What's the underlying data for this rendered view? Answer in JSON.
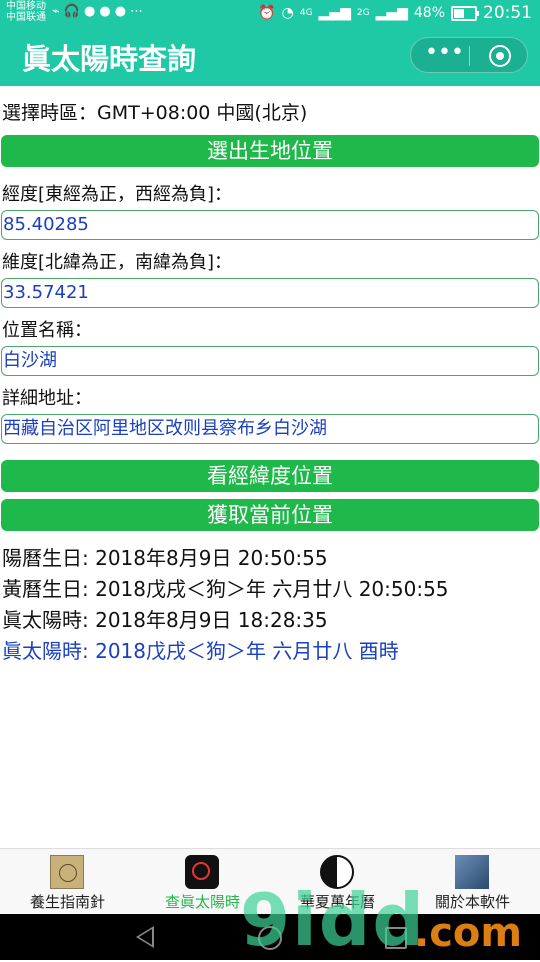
{
  "status_bar": {
    "carrier_1": "中国移动",
    "carrier_2": "中国联通",
    "battery_text": "48%",
    "battery_level": 0.48,
    "time": "20:51",
    "net_1": "4G",
    "net_2": "2G"
  },
  "title_bar": {
    "title": "眞太陽時查詢"
  },
  "timezone_text": "選擇時區：GMT+08:00 中國(北京)",
  "buttons": {
    "choose_birthplace": "選出生地位置",
    "view_location": "看經緯度位置",
    "get_current_location": "獲取當前位置"
  },
  "fields": {
    "longitude": {
      "label": "經度[東經為正，西經為負]：",
      "value": "85.40285"
    },
    "latitude": {
      "label": "維度[北緯為正，南緯為負]：",
      "value": "33.57421"
    },
    "location_name": {
      "label": "位置名稱：",
      "value": "白沙湖"
    },
    "address": {
      "label": "詳細地址：",
      "value": "西藏自治区阿里地区改则县察布乡白沙湖"
    }
  },
  "results": {
    "solar_birthday": "陽曆生日: 2018年8月9日 20:50:55",
    "lunar_birthday": "黃曆生日: 2018戊戌＜狗＞年 六月廿八 20:50:55",
    "true_solar_time": "眞太陽時: 2018年8月9日 18:28:35",
    "true_solar_time_lunar": "眞太陽時: 2018戊戌＜狗＞年 六月廿八 酉時"
  },
  "tab_bar": {
    "tabs": [
      {
        "label": "養生指南針",
        "icon": "compass-icon",
        "active": false
      },
      {
        "label": "查眞太陽時",
        "icon": "sun-clock-icon",
        "active": true
      },
      {
        "label": "華夏萬年曆",
        "icon": "yin-yang-icon",
        "active": false
      },
      {
        "label": "關於本軟件",
        "icon": "about-icon",
        "active": false
      }
    ]
  },
  "watermark": {
    "text": "9idd",
    "suffix": ".com"
  },
  "colors": {
    "header": "#1fc9a6",
    "button": "#1fb84a",
    "value_text": "#1a3fbf"
  }
}
